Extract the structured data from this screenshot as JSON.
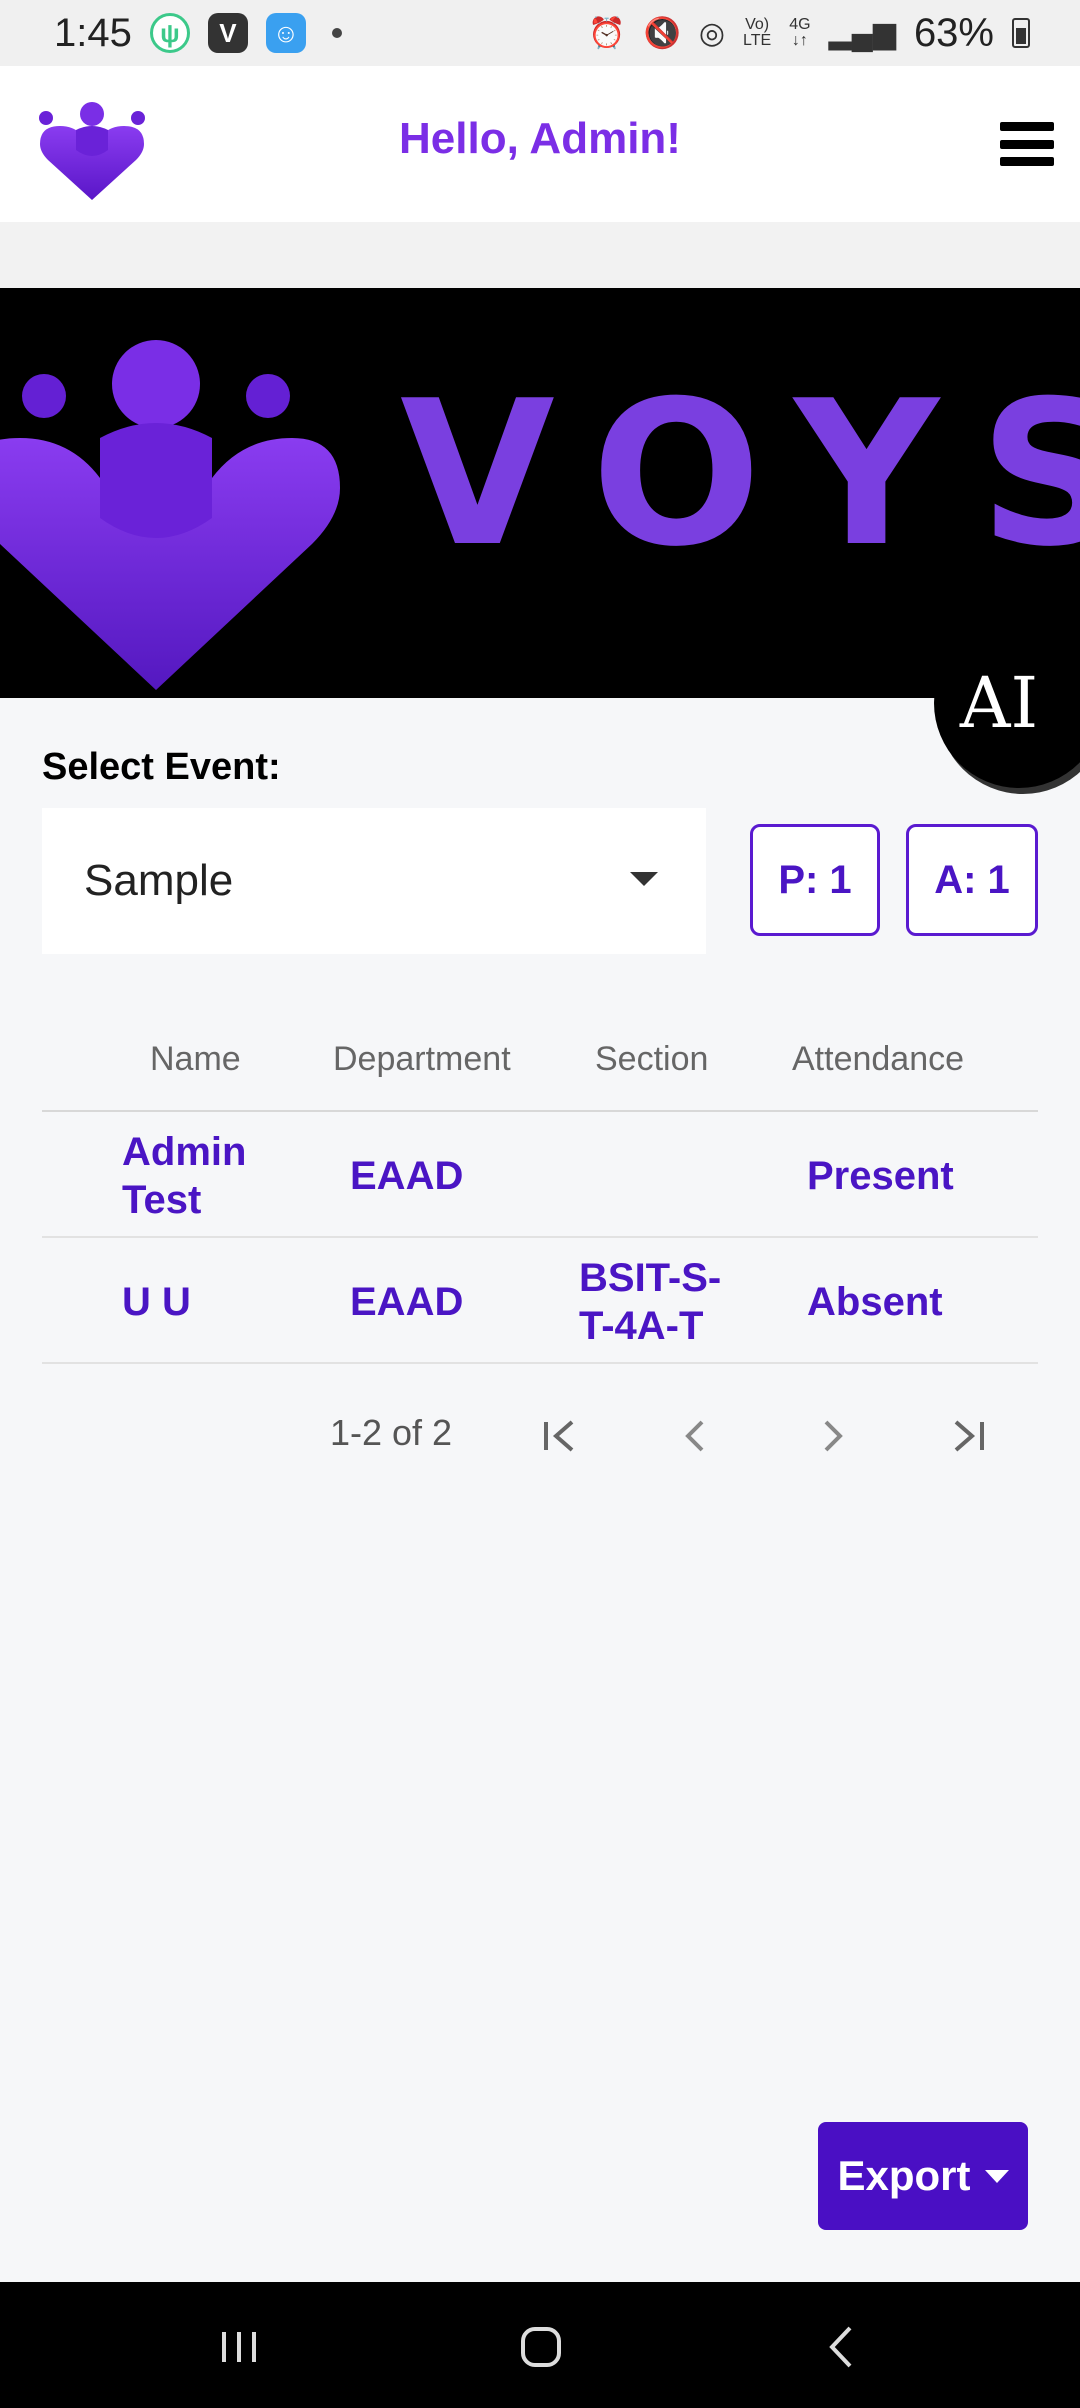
{
  "status_bar": {
    "time": "1:45",
    "app_icons": [
      "restaurant-app-icon",
      "v-app-icon",
      "bot-app-icon"
    ],
    "battery": "63%"
  },
  "header": {
    "greeting": "Hello, Admin!"
  },
  "banner": {
    "brand": "VOYS"
  },
  "ai_badge": "AI",
  "event_select": {
    "label": "Select Event:",
    "value": "Sample"
  },
  "counts": {
    "present": "P: 1",
    "absent": "A: 1"
  },
  "table": {
    "columns": [
      "Name",
      "Department",
      "Section",
      "Attendance"
    ],
    "rows": [
      {
        "name": "Admin Test",
        "department": "EAAD",
        "section": "",
        "attendance": "Present"
      },
      {
        "name": "U U",
        "department": "EAAD",
        "section": "BSIT-S-T-4A-T",
        "attendance": "Absent"
      }
    ]
  },
  "pagination": {
    "info": "1-2 of 2"
  },
  "export": {
    "label": "Export"
  },
  "colors": {
    "accent": "#7b2ee6",
    "primary_dark": "#4a0fc4",
    "banner_bg": "#000000"
  }
}
